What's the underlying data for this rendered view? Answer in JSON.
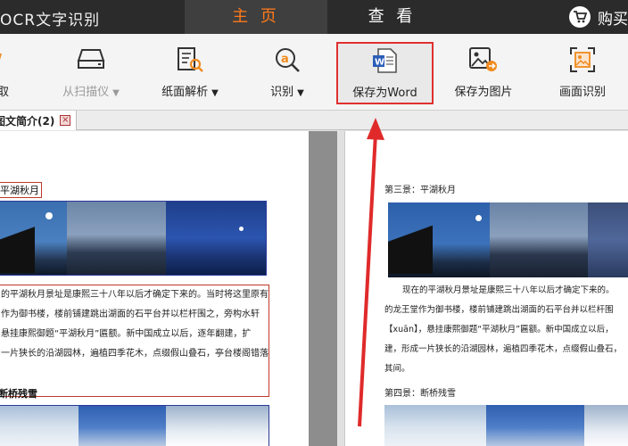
{
  "header": {
    "app_title": "OCR文字识别",
    "tabs": [
      {
        "label": "主 页",
        "active": true
      },
      {
        "label": "查 看",
        "active": false
      }
    ],
    "buy_label": "购买"
  },
  "toolbar": {
    "tools": [
      {
        "label": "取",
        "icon": "import-icon"
      },
      {
        "label": "从扫描仪",
        "icon": "scanner-icon",
        "disabled": true
      },
      {
        "label": "纸面解析",
        "icon": "page-analysis-icon"
      },
      {
        "label": "识别",
        "icon": "recognize-icon"
      },
      {
        "label": "保存为Word",
        "icon": "word-file-icon",
        "highlighted": true
      },
      {
        "label": "保存为图片",
        "icon": "save-image-icon"
      },
      {
        "label": "画面识别",
        "icon": "screen-capture-icon"
      }
    ]
  },
  "document_tab": {
    "label": "图文简介(2)"
  },
  "left_page": {
    "section1_title": "平湖秋月",
    "paragraph_lines": [
      "的平湖秋月景址是康熙三十八年以后才确定下来的。当时将这里原有",
      "作为御书楼，楼前铺建跳出湖面的石平台并以栏杆围之，旁构水轩",
      "悬挂康熙御题“平湖秋月”匾额。新中国成立以后，逐年翻建，扩",
      "一片狭长的沿湖园林，遍植四季花木，点缀假山叠石，亭台楼阁错落"
    ],
    "section2_title": "断桥残雪"
  },
  "right_page": {
    "section1_title": "第三景：平湖秋月",
    "paragraph_lines": [
      "现在的平湖秋月景址是康熙三十八年以后才确定下来的。",
      "的龙王堂作为御书楼，楼前铺建跳出湖面的石平台并以栏杆围",
      "【xuān】，悬挂康熙御题“平湖秋月”匾额。新中国成立以后，",
      "建，形成一片狭长的沿湖园林，遍植四季花木，点缀假山叠石，",
      "其间。"
    ],
    "section2_title": "第四景：断桥残雪"
  },
  "colors": {
    "topbar": "#2b2b2b",
    "accent_orange": "#ff7a1a",
    "highlight_red": "#e03030"
  }
}
